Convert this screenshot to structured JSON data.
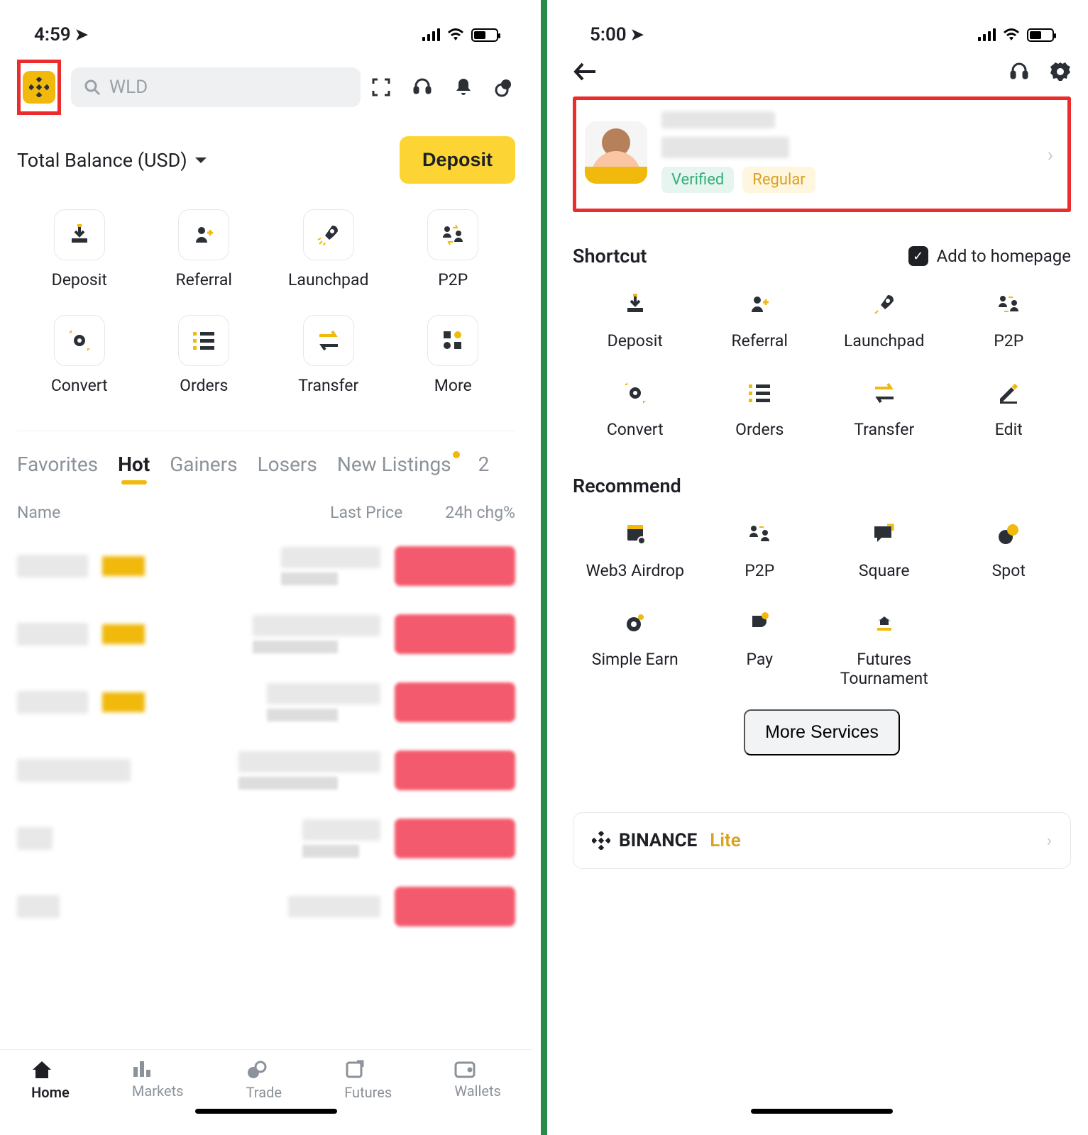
{
  "phone1": {
    "status_time": "4:59",
    "search_placeholder": "WLD",
    "balance_label": "Total Balance (USD)",
    "deposit_button": "Deposit",
    "shortcuts": [
      {
        "label": "Deposit"
      },
      {
        "label": "Referral"
      },
      {
        "label": "Launchpad"
      },
      {
        "label": "P2P"
      },
      {
        "label": "Convert"
      },
      {
        "label": "Orders"
      },
      {
        "label": "Transfer"
      },
      {
        "label": "More"
      }
    ],
    "tabs": [
      "Favorites",
      "Hot",
      "Gainers",
      "Losers",
      "New Listings",
      "2"
    ],
    "active_tab": "Hot",
    "table_headers": {
      "name": "Name",
      "price": "Last Price",
      "chg": "24h chg%"
    },
    "nav": [
      {
        "label": "Home",
        "active": true
      },
      {
        "label": "Markets",
        "active": false
      },
      {
        "label": "Trade",
        "active": false
      },
      {
        "label": "Futures",
        "active": false
      },
      {
        "label": "Wallets",
        "active": false
      }
    ]
  },
  "phone2": {
    "status_time": "5:00",
    "badges": {
      "verified": "Verified",
      "regular": "Regular"
    },
    "shortcut_title": "Shortcut",
    "add_homepage": "Add to homepage",
    "shortcuts": [
      {
        "label": "Deposit"
      },
      {
        "label": "Referral"
      },
      {
        "label": "Launchpad"
      },
      {
        "label": "P2P"
      },
      {
        "label": "Convert"
      },
      {
        "label": "Orders"
      },
      {
        "label": "Transfer"
      },
      {
        "label": "Edit"
      }
    ],
    "recommend_title": "Recommend",
    "recommend": [
      {
        "label": "Web3 Airdrop"
      },
      {
        "label": "P2P"
      },
      {
        "label": "Square"
      },
      {
        "label": "Spot"
      },
      {
        "label": "Simple Earn"
      },
      {
        "label": "Pay"
      },
      {
        "label": "Futures Tournament"
      }
    ],
    "more_services": "More Services",
    "binance_brand": "BINANCE",
    "lite": "Lite"
  }
}
